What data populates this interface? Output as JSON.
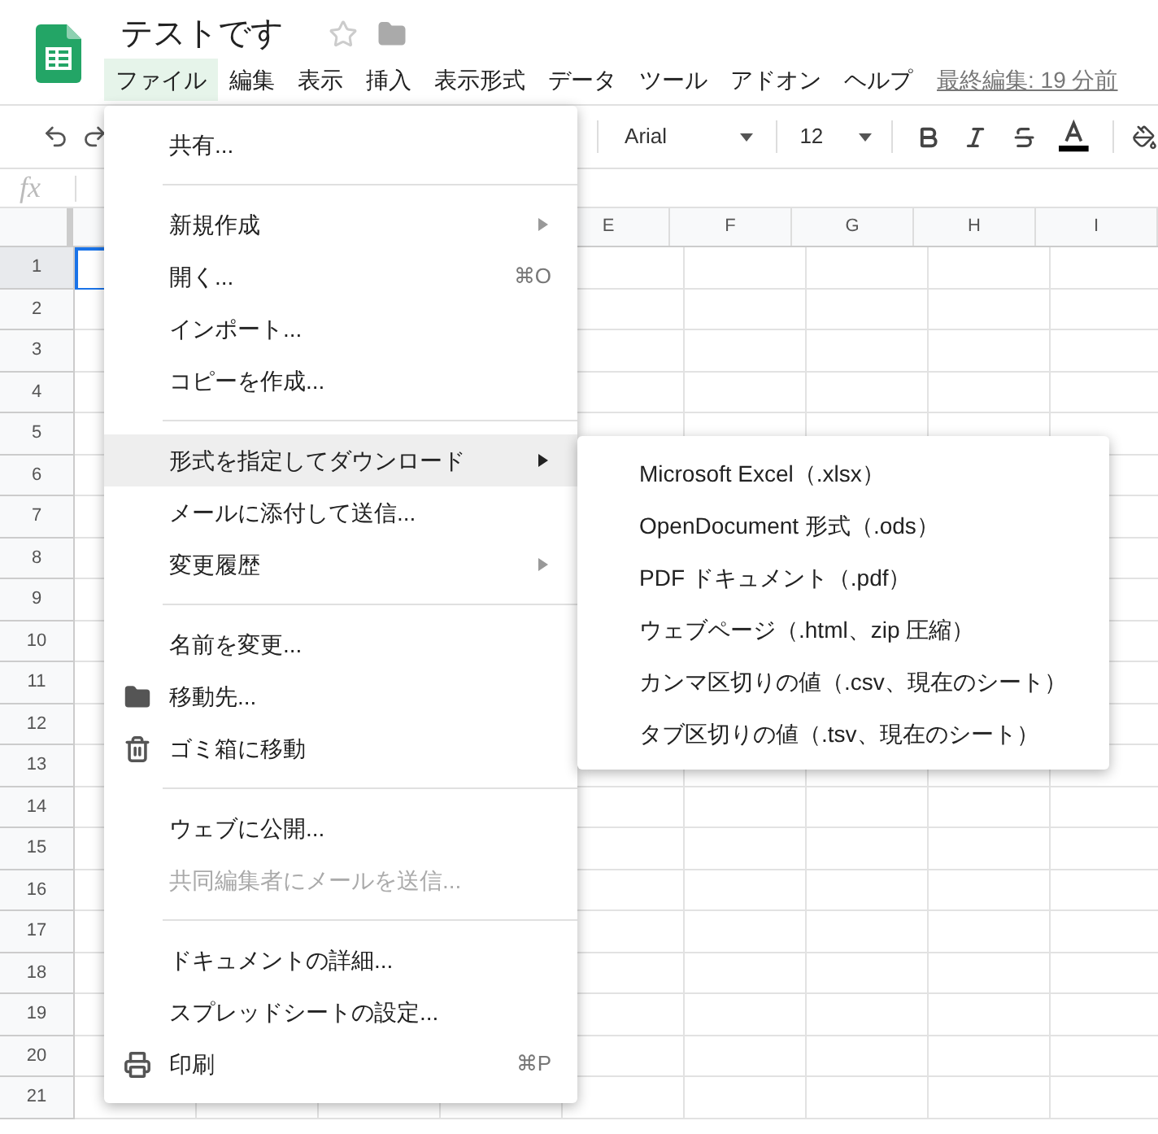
{
  "doc": {
    "title": "テストです"
  },
  "menubar": [
    {
      "label": "ファイル",
      "selected": true
    },
    {
      "label": "編集",
      "selected": false
    },
    {
      "label": "表示",
      "selected": false
    },
    {
      "label": "挿入",
      "selected": false
    },
    {
      "label": "表示形式",
      "selected": false
    },
    {
      "label": "データ",
      "selected": false
    },
    {
      "label": "ツール",
      "selected": false
    },
    {
      "label": "アドオン",
      "selected": false
    },
    {
      "label": "ヘルプ",
      "selected": false
    }
  ],
  "last_edit": "最終編集: 19 分前",
  "toolbar": {
    "font": "Arial",
    "size": "12"
  },
  "formula_bar": {
    "label": "fx"
  },
  "sheet": {
    "columns": [
      "E",
      "F",
      "G",
      "H",
      "I"
    ],
    "rows": [
      {
        "label": "1",
        "selected": true
      },
      {
        "label": "2",
        "selected": false
      },
      {
        "label": "3",
        "selected": false
      },
      {
        "label": "4",
        "selected": false
      },
      {
        "label": "5",
        "selected": false
      },
      {
        "label": "6",
        "selected": false
      },
      {
        "label": "7",
        "selected": false
      },
      {
        "label": "8",
        "selected": false
      },
      {
        "label": "9",
        "selected": false
      },
      {
        "label": "10",
        "selected": false
      },
      {
        "label": "11",
        "selected": false
      },
      {
        "label": "12",
        "selected": false
      },
      {
        "label": "13",
        "selected": false
      },
      {
        "label": "14",
        "selected": false
      },
      {
        "label": "15",
        "selected": false
      },
      {
        "label": "16",
        "selected": false
      },
      {
        "label": "17",
        "selected": false
      },
      {
        "label": "18",
        "selected": false
      },
      {
        "label": "19",
        "selected": false
      },
      {
        "label": "20",
        "selected": false
      },
      {
        "label": "21",
        "selected": false
      }
    ]
  },
  "file_menu": {
    "sections": [
      [
        {
          "label": "共有...",
          "selected": false,
          "disabled": false,
          "has_submenu": false
        }
      ],
      [
        {
          "label": "新規作成",
          "selected": false,
          "disabled": false,
          "has_submenu": true
        },
        {
          "label": "開く...",
          "shortcut": "⌘O",
          "selected": false,
          "disabled": false,
          "has_submenu": false
        },
        {
          "label": "インポート...",
          "selected": false,
          "disabled": false,
          "has_submenu": false
        },
        {
          "label": "コピーを作成...",
          "selected": false,
          "disabled": false,
          "has_submenu": false
        }
      ],
      [
        {
          "label": "形式を指定してダウンロード",
          "selected": true,
          "disabled": false,
          "has_submenu": true
        },
        {
          "label": "メールに添付して送信...",
          "selected": false,
          "disabled": false,
          "has_submenu": false
        },
        {
          "label": "変更履歴",
          "selected": false,
          "disabled": false,
          "has_submenu": true
        }
      ],
      [
        {
          "label": "名前を変更...",
          "selected": false,
          "disabled": false,
          "has_submenu": false
        },
        {
          "label": "移動先...",
          "kind": "folder",
          "selected": false,
          "disabled": false,
          "has_submenu": false
        },
        {
          "label": "ゴミ箱に移動",
          "kind": "trash",
          "selected": false,
          "disabled": false,
          "has_submenu": false
        }
      ],
      [
        {
          "label": "ウェブに公開...",
          "selected": false,
          "disabled": false,
          "has_submenu": false
        },
        {
          "label": "共同編集者にメールを送信...",
          "selected": false,
          "disabled": true,
          "has_submenu": false
        }
      ],
      [
        {
          "label": "ドキュメントの詳細...",
          "selected": false,
          "disabled": false,
          "has_submenu": false
        },
        {
          "label": "スプレッドシートの設定...",
          "selected": false,
          "disabled": false,
          "has_submenu": false
        },
        {
          "label": "印刷",
          "kind": "print",
          "shortcut": "⌘P",
          "selected": false,
          "disabled": false,
          "has_submenu": false
        }
      ]
    ]
  },
  "submenu": {
    "items": [
      "Microsoft Excel（.xlsx）",
      "OpenDocument 形式（.ods）",
      "PDF ドキュメント（.pdf）",
      "ウェブページ（.html、zip 圧縮）",
      "カンマ区切りの値（.csv、現在のシート）",
      "タブ区切りの値（.tsv、現在のシート）"
    ]
  }
}
